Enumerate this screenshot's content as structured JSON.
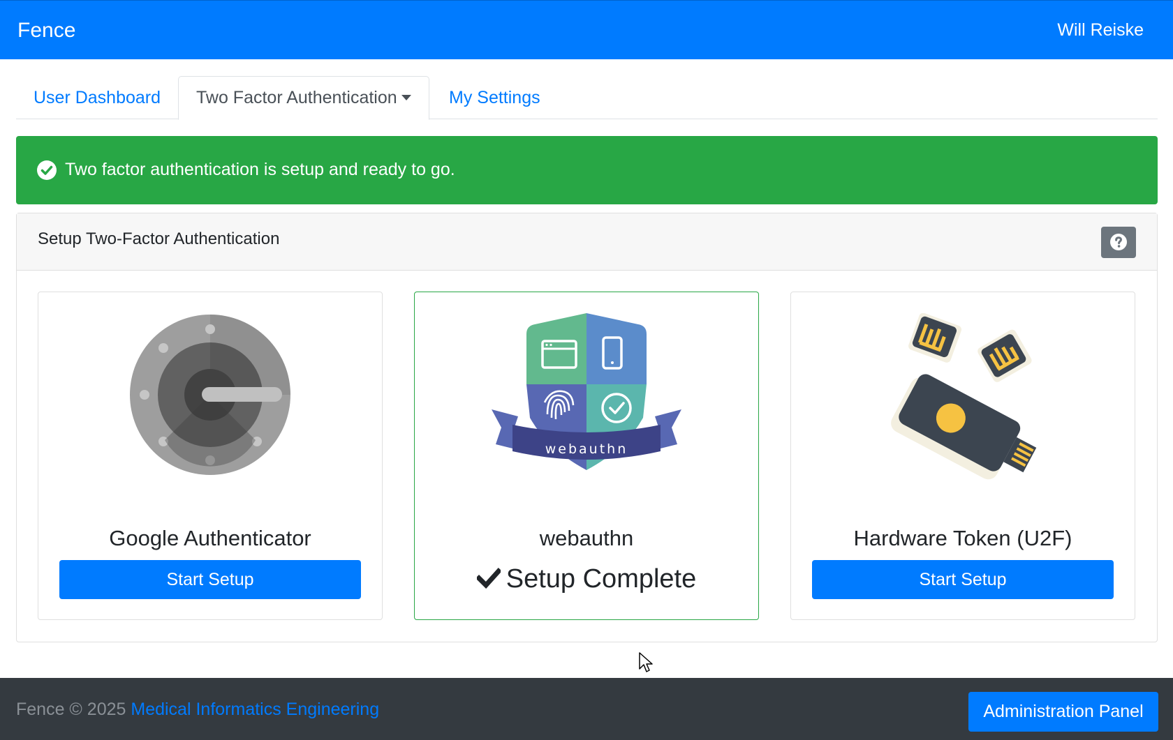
{
  "navbar": {
    "brand": "Fence",
    "user": "Will Reiske",
    "color": "#007bff"
  },
  "tabs": [
    {
      "label": "User Dashboard"
    },
    {
      "label": "Two Factor Authentication"
    },
    {
      "label": "My Settings"
    }
  ],
  "alert": {
    "text": "Two factor authentication is setup and ready to go.",
    "icon": "check-circle-icon",
    "color": "#28a745"
  },
  "card": {
    "title": "Setup Two-Factor Authentication",
    "help_icon": "question-circle-icon"
  },
  "options": [
    {
      "title": "Google Authenticator",
      "button": "Start Setup",
      "icon": "google-authenticator-icon"
    },
    {
      "title": "webauthn",
      "status": "Setup Complete",
      "badge_text": "webauthn",
      "icon": "webauthn-icon"
    },
    {
      "title": "Hardware Token (U2F)",
      "button": "Start Setup",
      "icon": "hardware-token-icon"
    }
  ],
  "footer": {
    "text": "Fence © 2025",
    "link": "Medical Informatics Engineering",
    "admin_button": "Administration Panel"
  }
}
